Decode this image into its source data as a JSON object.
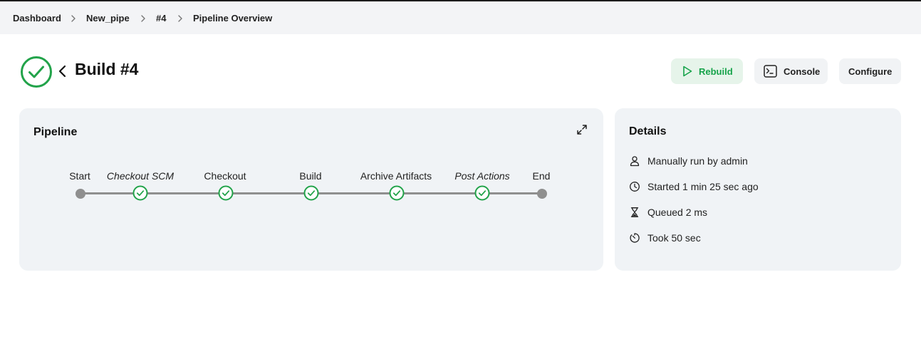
{
  "breadcrumb": {
    "items": [
      "Dashboard",
      "New_pipe",
      "#4",
      "Pipeline Overview"
    ]
  },
  "header": {
    "title": "Build #4",
    "status": "success",
    "status_color": "#22a34a"
  },
  "actions": {
    "rebuild_label": "Rebuild",
    "console_label": "Console",
    "configure_label": "Configure"
  },
  "pipeline": {
    "title": "Pipeline",
    "stages": [
      {
        "label": "Start",
        "italic": false,
        "state": "endpoint"
      },
      {
        "label": "Checkout SCM",
        "italic": true,
        "state": "success"
      },
      {
        "label": "Checkout",
        "italic": false,
        "state": "success"
      },
      {
        "label": "Build",
        "italic": false,
        "state": "success"
      },
      {
        "label": "Archive Artifacts",
        "italic": false,
        "state": "success"
      },
      {
        "label": "Post Actions",
        "italic": true,
        "state": "success"
      },
      {
        "label": "End",
        "italic": false,
        "state": "endpoint"
      }
    ]
  },
  "details": {
    "title": "Details",
    "rows": [
      {
        "icon": "user-icon",
        "text": "Manually run by admin"
      },
      {
        "icon": "clock-icon",
        "text": "Started 1 min 25 sec ago"
      },
      {
        "icon": "hourglass-icon",
        "text": "Queued 2 ms"
      },
      {
        "icon": "timer-icon",
        "text": "Took 50 sec"
      }
    ]
  },
  "colors": {
    "success": "#22a34a",
    "rebuild_bg": "#e6f4ea",
    "card_bg": "#f0f3f6",
    "track": "#8f8f8f"
  }
}
